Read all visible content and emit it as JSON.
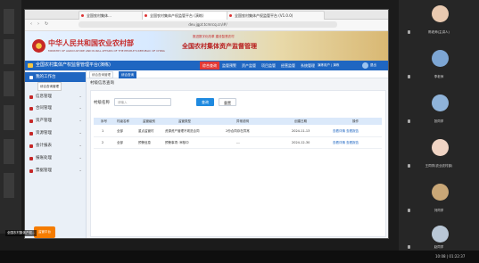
{
  "browser": {
    "tabs": [
      {
        "label": "全国农村集体…"
      },
      {
        "label": "全国农村集体产权监管平台 (演练)"
      },
      {
        "label": "全国农村集体产权监管平台 (V1.0.0)"
      }
    ],
    "url": "dev.jgpt.tcmrcq.cn/#/",
    "nav_back": "‹",
    "nav_forward": "›",
    "nav_reload": "↻"
  },
  "banner": {
    "title": "中华人民共和国农业农村部",
    "subtitle": "MINISTRY OF AGRICULTURE AND RURAL AFFAIRS OF THE PEOPLE'S REPUBLIC OF CHINA",
    "slogan": "推进数字化改革 建设智慧农村",
    "platform": "全国农村集体资产监督管理"
  },
  "topnav": {
    "system_name": "全国农村集体产权监督管理平台(演练)",
    "menus": [
      "综合查询",
      "监管预警",
      "资产监管",
      "项目监管",
      "经营监管",
      "系统管理"
    ],
    "active_menu": 0,
    "user_info": "演练用户 | 演练",
    "logout": "退出"
  },
  "sidebar": {
    "items": [
      {
        "label": "我的工作台",
        "tooltip": "综合查询管理"
      },
      {
        "label": "信息管理"
      },
      {
        "label": "合同管理"
      },
      {
        "label": "资产管理"
      },
      {
        "label": "资源管理"
      },
      {
        "label": "会计报表"
      },
      {
        "label": "报账处理"
      },
      {
        "label": "票据管理"
      }
    ],
    "footer": "监管平台"
  },
  "main": {
    "tabs": [
      {
        "label": "综合查询管理",
        "active": false
      },
      {
        "label": "综合查询",
        "active": true
      }
    ],
    "page_title": "村级信息查询",
    "search": {
      "label": "村级名称",
      "placeholder": "请输入",
      "query_label": "查询",
      "reset_label": "重置"
    },
    "table": {
      "headers": [
        "序号",
        "村级名称",
        "监管级别",
        "监管类型",
        "异常说明",
        "创建日期",
        "操作"
      ],
      "rows": [
        [
          "1",
          "全部",
          "重点监管村",
          "资源资产管理不规范合同",
          "2份合同存在异常",
          "2024-11-13",
          "查看详情 查看报告"
        ],
        [
          "2",
          "全部",
          "预警信息",
          "预警事项: 审核中",
          "---",
          "2024-12-30",
          "查看详情 查看报告"
        ]
      ]
    }
  },
  "participants": [
    {
      "name": "陈老师(主讲人)",
      "color": "#e8c9b0"
    },
    {
      "name": "李老师",
      "color": "#7da6d4"
    },
    {
      "name": "张同学",
      "color": "#8fb3d9"
    },
    {
      "name": "王同学(农业农村部)",
      "color": "#f0d4c4"
    },
    {
      "name": "刘同学",
      "color": "#c9a777"
    },
    {
      "name": "赵同学",
      "color": "#b9c7d6"
    }
  ],
  "active_speaker": "全国农村集体产权...",
  "meeting_clock": "10:08 | 01:22:37"
}
